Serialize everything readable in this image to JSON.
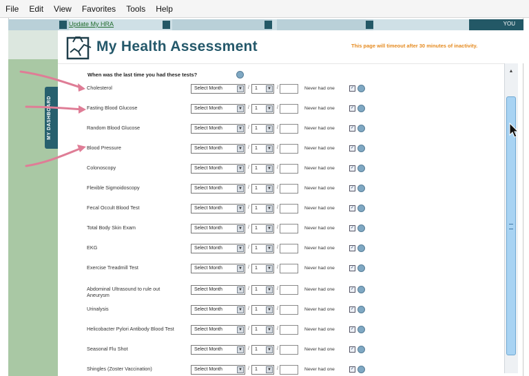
{
  "menu": {
    "items": [
      "File",
      "Edit",
      "View",
      "Favorites",
      "Tools",
      "Help"
    ]
  },
  "nav": {
    "link_label": "Update My HRA",
    "right_label": "YOU"
  },
  "sidebar": {
    "tab_label": "MY DASHBOARD"
  },
  "page": {
    "title": "My Health Assessment",
    "timeout_notice": "This page will timeout after 30 minutes of inactivity.",
    "question": "When was the last time you had these tests?"
  },
  "form": {
    "month_placeholder": "Select Month",
    "day_default": "1",
    "never_label": "Never had one",
    "rows": [
      {
        "label": "Cholesterol"
      },
      {
        "label": "Fasting Blood Glucose"
      },
      {
        "label": "Random Blood Glucose"
      },
      {
        "label": "Blood Pressure"
      },
      {
        "label": "Colonoscopy"
      },
      {
        "label": "Flexible Sigmoidoscopy"
      },
      {
        "label": "Fecal Occult Blood Test"
      },
      {
        "label": "Total Body Skin Exam"
      },
      {
        "label": "EKG"
      },
      {
        "label": "Exercise Treadmill Test"
      },
      {
        "label": "Abdominal Ultrasound to rule out Aneurysm"
      },
      {
        "label": "Urinalysis"
      },
      {
        "label": "Helicobacter Pylori Antibody Blood Test"
      },
      {
        "label": "Seasonal Flu Shot"
      },
      {
        "label": "Shingles (Zoster Vaccination)"
      }
    ]
  },
  "colors": {
    "brand_teal": "#24586a",
    "sidebar_green": "#a9c8a4",
    "timeout_orange": "#e58a1f",
    "annotation_pink": "#df7d96"
  },
  "icons": {
    "logo": "clipboard-chart-icon",
    "help": "help-circle-icon",
    "checkbox": "checkbox-icon",
    "dropdown": "chevron-down-icon"
  }
}
